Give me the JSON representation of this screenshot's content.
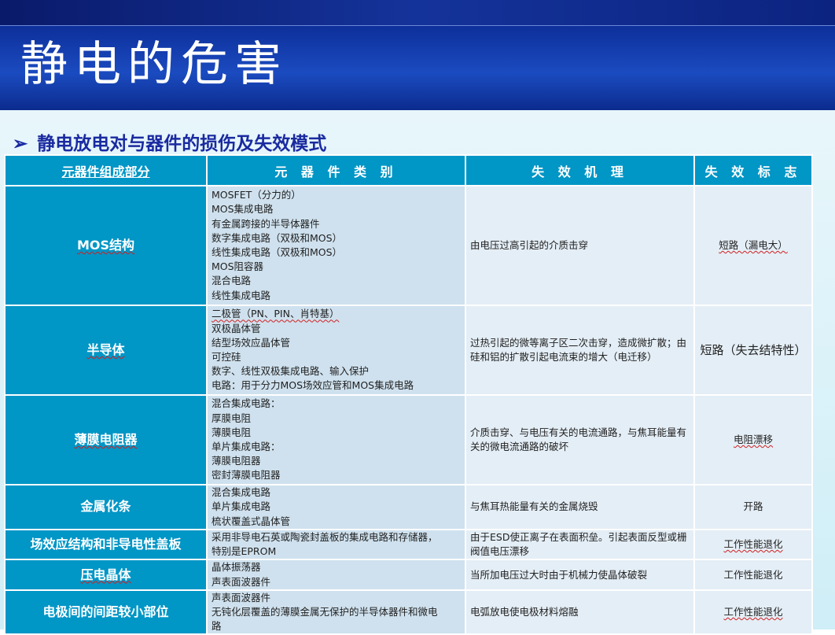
{
  "slide": {
    "title": "静电的危害",
    "subtitle": "静电放电对与器件的损伤及失效模式"
  },
  "table": {
    "headers": [
      "元器件组成部分",
      "元 器 件 类 别",
      "失 效 机 理",
      "失 效 标 志"
    ],
    "rows": [
      {
        "component": "MOS结构",
        "items": [
          "MOSFET（分力的）",
          "MOS集成电路",
          "有金属跨接的半导体器件",
          "数字集成电路（双极和MOS）",
          "线性集成电路（双极和MOS）",
          "MOS阻容器",
          "混合电路",
          "线性集成电路"
        ],
        "mechanism": "由电压过高引起的介质击穿",
        "failure": "短路（漏电大）"
      },
      {
        "component": "半导体",
        "items": [
          "二极管（PN、PIN、肖特基）",
          "双极晶体管",
          "结型场效应晶体管",
          "可控硅",
          "数字、线性双极集成电路、输入保护",
          "电路：用于分力MOS场效应管和MOS集成电路"
        ],
        "mechanism": "过热引起的微等离子区二次击穿，造成微扩散；由硅和铝的扩散引起电流束的增大（电迁移）",
        "failure": "短路（失去结特性）"
      },
      {
        "component": "薄膜电阻器",
        "items": [
          "混合集成电路：",
          "厚膜电阻",
          "薄膜电阻",
          "单片集成电路：",
          "薄膜电阻器",
          "密封薄膜电阻器"
        ],
        "mechanism": "介质击穿、与电压有关的电流通路，与焦耳能量有关的微电流通路的破坏",
        "failure": "电阻漂移"
      },
      {
        "component": "金属化条",
        "items": [
          "混合集成电路",
          "单片集成电路",
          "梳状覆盖式晶体管"
        ],
        "mechanism": "与焦耳热能量有关的金属烧毁",
        "failure": "开路"
      },
      {
        "component": "场效应结构和非导电性盖板",
        "items": [
          "采用非导电石英或陶瓷封盖板的集成电路和存储器，",
          "特别是EPROM"
        ],
        "mechanism": "由于ESD使正离子在表面积垒。引起表面反型或栅阀值电压漂移",
        "failure": "工作性能退化"
      },
      {
        "component": "压电晶体",
        "items": [
          "晶体振荡器",
          "声表面波器件"
        ],
        "mechanism": "当所加电压过大时由于机械力使晶体破裂",
        "failure": "工作性能退化"
      },
      {
        "component": "电极间的间距较小部位",
        "items": [
          "声表面波器件",
          "无钝化层覆盖的薄膜金属无保护的半导体器件和微电",
          "路"
        ],
        "mechanism": "电弧放电使电极材料熔融",
        "failure": "工作性能退化"
      }
    ]
  }
}
